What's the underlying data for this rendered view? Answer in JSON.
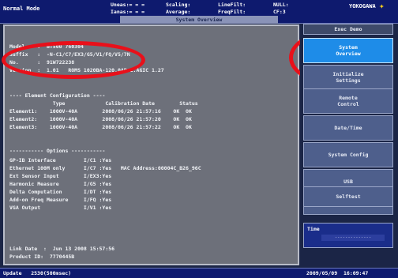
{
  "topbar": {
    "mode": "Normal Mode",
    "col1": [
      "Uneas:= = =",
      "Ianas:= = ="
    ],
    "col2": [
      "Scaling:",
      "Average:"
    ],
    "col3": [
      "LineFilt:",
      "FreqFilt:"
    ],
    "col4": [
      "NULL:",
      "CF:3"
    ],
    "brand": "YOKOGAWA",
    "brand_star": "✦",
    "title": "System Overview"
  },
  "panel": {
    "model": "Model    :  WT500 760304",
    "suffix": "Suffix   :  -N-C1/C7/EX3/G5/V1/FQ/V5/7N",
    "no": "No.      :  91W722238",
    "version": "Version  :  1.01   ROMS 1020BA-120.0AP 1.AGIC 1.27",
    "element_header": "---- Element Configuration ----",
    "element_columns": "              Type             Calibration Date        Status",
    "elements": [
      "Element1:    1000V-40A        2008/06/26 21:57:16    OK  OK",
      "Element2:    1000V-40A        2008/06/26 21:57:20    OK  OK",
      "Element3:    1000V-40A        2008/06/26 21:57:22    OK  OK"
    ],
    "options_header": "----------- Options -----------",
    "options": [
      "GP-IB Interface         I/C1 :Yes",
      "Ethernet 100M only      I/C7 :Yes   MAC Address:00004C_B26_96C",
      "Ext Sensor Input        I/EX3:Yes",
      "Harmonic Measure        I/G5 :Yes",
      "Delta Computation       I/DT :Yes",
      "Add-on Freq Measure     I/FQ :Yes",
      "VGA Output              I/V1 :Yes"
    ],
    "link_date": "Link Date  :  Jun 13 2008 15:57:56",
    "product_id": "Product ID:  7770445B"
  },
  "menu": {
    "items": [
      "Exec Demo",
      "System\nOverview",
      "Initialize\nSettings",
      "Remote\nControl",
      "Date/Time",
      "System Config",
      "USB",
      "Network",
      "Selftest"
    ],
    "time_label": "Time",
    "time_value": "--------------"
  },
  "bottombar": {
    "left": "Update   2530(500msec)",
    "right": "2009/05/09  16:09:47"
  },
  "colors": {
    "accent": "#1e8ce8",
    "annotation": "#e8101a",
    "bar": "#0e1a6e",
    "panel": "#6d707a"
  }
}
